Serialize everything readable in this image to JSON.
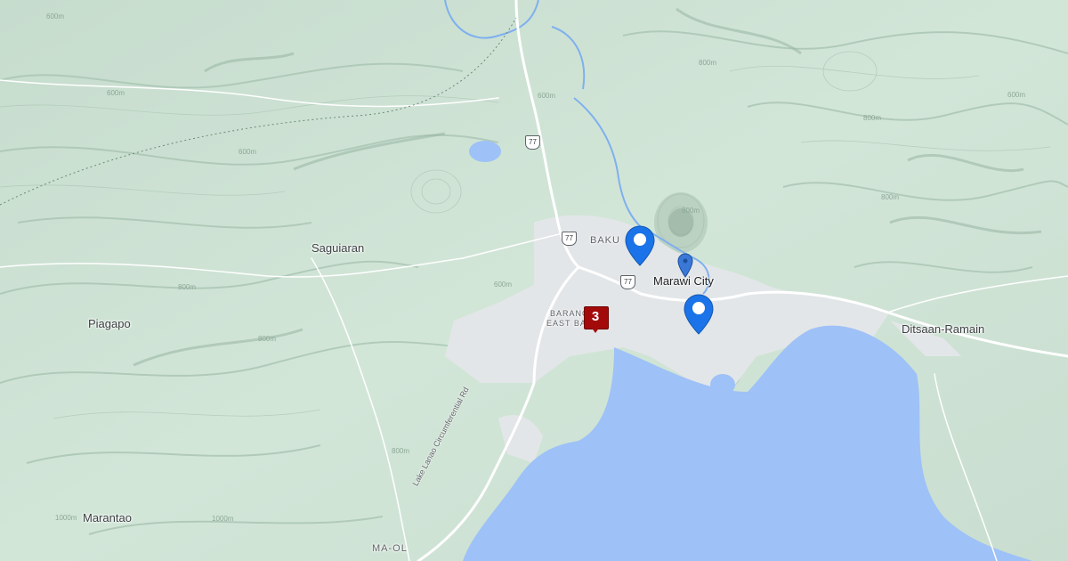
{
  "map": {
    "places": [
      {
        "id": "saguiaran",
        "label": "Saguiaran"
      },
      {
        "id": "piagapo",
        "label": "Piagapo"
      },
      {
        "id": "marantao",
        "label": "Marantao"
      },
      {
        "id": "marawi-city",
        "label": "Marawi City"
      },
      {
        "id": "ditsaan-ramain",
        "label": "Ditsaan-Ramain"
      },
      {
        "id": "bakut",
        "label": "BAKU"
      },
      {
        "id": "barangay-1",
        "label": "BARANG"
      },
      {
        "id": "barangay-2",
        "label": "EAST BA"
      },
      {
        "id": "ma-ol",
        "label": "MA-OL"
      }
    ],
    "road_label": "Lake Lanao Circumferential Rd",
    "route_shields": [
      "77",
      "77",
      "77"
    ],
    "contour_labels": [
      "600m",
      "600m",
      "600m",
      "600m",
      "800m",
      "800m",
      "800m",
      "800m",
      "800m",
      "600m",
      "800m",
      "1000m",
      "1000m",
      "800m",
      "600m"
    ],
    "markers": {
      "cluster_count": "3",
      "pins": [
        {
          "type": "location-pin-large",
          "color": "#1a73e8"
        },
        {
          "type": "location-pin-large",
          "color": "#1a73e8"
        },
        {
          "type": "location-pin-small",
          "color": "#3a78d8"
        }
      ]
    },
    "colors": {
      "land": "#cfe3d6",
      "water": "#9ec1f7",
      "urban": "#e3e6e8",
      "road": "#ffffff",
      "cluster": "#a30b0b"
    }
  }
}
